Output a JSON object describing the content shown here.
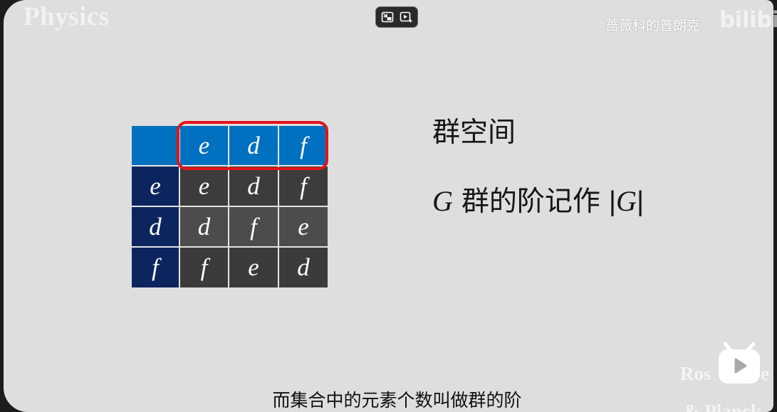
{
  "watermarks": {
    "top_left": "Physics",
    "channel": "蔷薇科的普朗克",
    "brand": "bilibili",
    "bottom_right_a": "Ros",
    "bottom_right_b": "e",
    "bottom_right_line2": "& Planck"
  },
  "player_controls": {
    "icons": [
      "picture-in-picture-exit-icon",
      "video-sparkle-icon"
    ]
  },
  "floating_button": {
    "icon": "bilibili-tv-play-icon"
  },
  "table": {
    "header": [
      "",
      "e",
      "d",
      "f"
    ],
    "rows": [
      [
        "e",
        "e",
        "d",
        "f"
      ],
      [
        "d",
        "d",
        "f",
        "e"
      ],
      [
        "f",
        "f",
        "e",
        "d"
      ]
    ]
  },
  "slide": {
    "title": "群空间",
    "line2": {
      "var": "G",
      "text": "群的阶记作",
      "abs_left": "|",
      "abs_var": "G",
      "abs_right": "|"
    }
  },
  "subtitle": "而集合中的元素个数叫做群的阶",
  "colors": {
    "header_blue": "#0070c0",
    "side_navy": "#0d255e",
    "cell_gray": "#3c3c3c",
    "highlight_red": "#e3141b",
    "slide_bg": "#dedede"
  }
}
